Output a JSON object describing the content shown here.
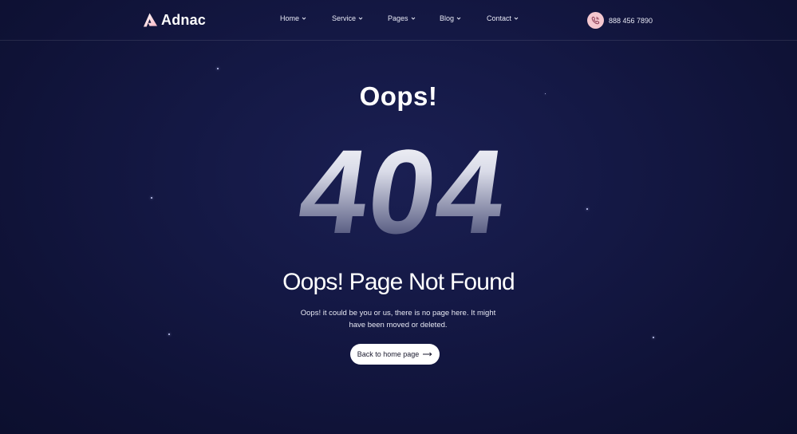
{
  "header": {
    "brand": "Adnac",
    "nav": [
      {
        "label": "Home",
        "icon": "chevron-down-icon"
      },
      {
        "label": "Service",
        "icon": "chevron-down-icon"
      },
      {
        "label": "Pages",
        "icon": "chevron-down-icon"
      },
      {
        "label": "Blog",
        "icon": "chevron-down-icon"
      },
      {
        "label": "Contact",
        "icon": "chevron-down-icon"
      }
    ],
    "phone": {
      "number": "888 456 7890",
      "icon": "phone-icon"
    }
  },
  "main": {
    "oops": "Oops!",
    "error_code": "404",
    "title": "Oops! Page Not Found",
    "description_line1": "Oops! it could be you or us, there is no page here. It might",
    "description_line2": "have been moved or deleted.",
    "home_button": {
      "label": "Back to home page",
      "icon": "arrow-right-icon"
    }
  },
  "colors": {
    "background": "#141844",
    "text": "#ffffff",
    "accent": "#f4c7cf",
    "button_bg": "#ffffff"
  }
}
